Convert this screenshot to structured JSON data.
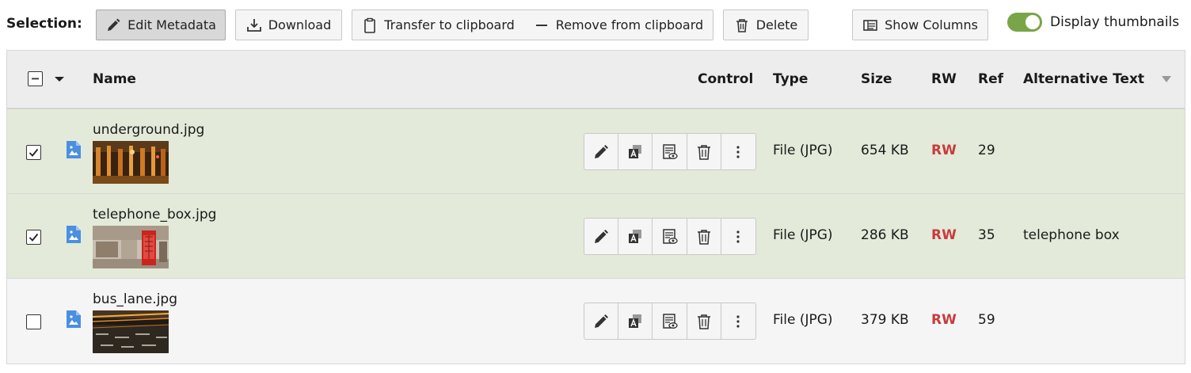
{
  "toolbar": {
    "selection_label": "Selection:",
    "edit_metadata": "Edit Metadata",
    "download": "Download",
    "transfer_clipboard": "Transfer to clipboard",
    "remove_clipboard": "Remove from clipboard",
    "delete": "Delete",
    "show_columns": "Show Columns",
    "display_thumbnails": "Display thumbnails",
    "display_thumbnails_on": true
  },
  "columns": {
    "name": "Name",
    "control": "Control",
    "type": "Type",
    "size": "Size",
    "rw": "RW",
    "ref": "Ref",
    "alt_text": "Alternative Text"
  },
  "rows": [
    {
      "checked": true,
      "name": "underground.jpg",
      "type": "File (JPG)",
      "size": "654 KB",
      "rw": "RW",
      "ref": "29",
      "alt_text": ""
    },
    {
      "checked": true,
      "name": "telephone_box.jpg",
      "type": "File (JPG)",
      "size": "286 KB",
      "rw": "RW",
      "ref": "35",
      "alt_text": "telephone box"
    },
    {
      "checked": false,
      "name": "bus_lane.jpg",
      "type": "File (JPG)",
      "size": "379 KB",
      "rw": "RW",
      "ref": "59",
      "alt_text": ""
    }
  ],
  "colors": {
    "selected_row": "#e3ead9",
    "rw_red": "#c83c3c",
    "toggle_green": "#79a548",
    "file_icon_blue": "#4a8fe0"
  }
}
